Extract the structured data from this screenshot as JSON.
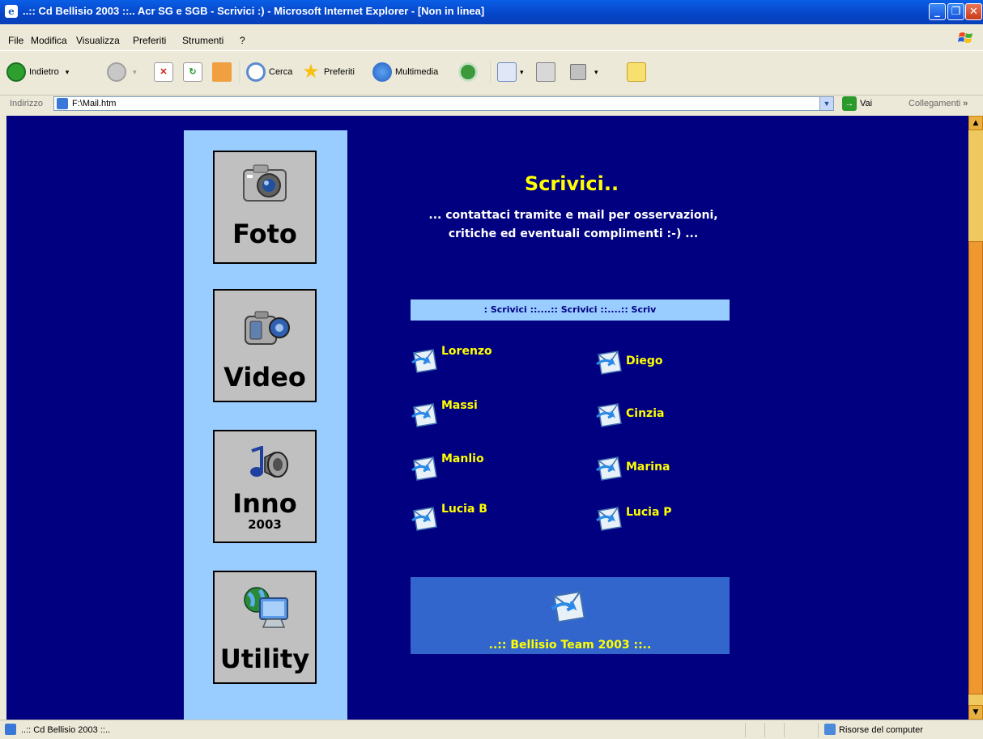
{
  "window": {
    "title": "..:: Cd Bellisio 2003 ::.. Acr SG e SGB - Scrivici :) - Microsoft Internet Explorer - [Non in linea]"
  },
  "menu": [
    "File",
    "Modifica",
    "Visualizza",
    "Preferiti",
    "Strumenti",
    "?"
  ],
  "toolbar": {
    "back": "Indietro",
    "search": "Cerca",
    "favorites": "Preferiti",
    "media": "Multimedia"
  },
  "address": {
    "label": "Indirizzo",
    "value": "F:\\Mail.htm",
    "go": "Vai",
    "links": "Collegamenti"
  },
  "page": {
    "nav": [
      {
        "label": "Foto",
        "sub": ""
      },
      {
        "label": "Video",
        "sub": ""
      },
      {
        "label": "Inno",
        "sub": "2003"
      },
      {
        "label": "Utility",
        "sub": ""
      }
    ],
    "heading": "Scrivici..",
    "intro_line1": "... contattaci tramite e mail per osservazioni,",
    "intro_line2": "critiche ed eventuali complimenti :-) ...",
    "marquee": ": Scrivici ::....:: Scrivici ::....:: Scriv",
    "contacts_left": [
      "Lorenzo",
      "Massi",
      "Manlio",
      "Lucia B"
    ],
    "contacts_right": [
      "Diego",
      "Cinzia",
      "Marina",
      "Lucia P"
    ],
    "team": "..:: Bellisio Team 2003 ::.."
  },
  "status": {
    "text": "..:: Cd Bellisio 2003 ::..",
    "zone": "Risorse del computer"
  }
}
